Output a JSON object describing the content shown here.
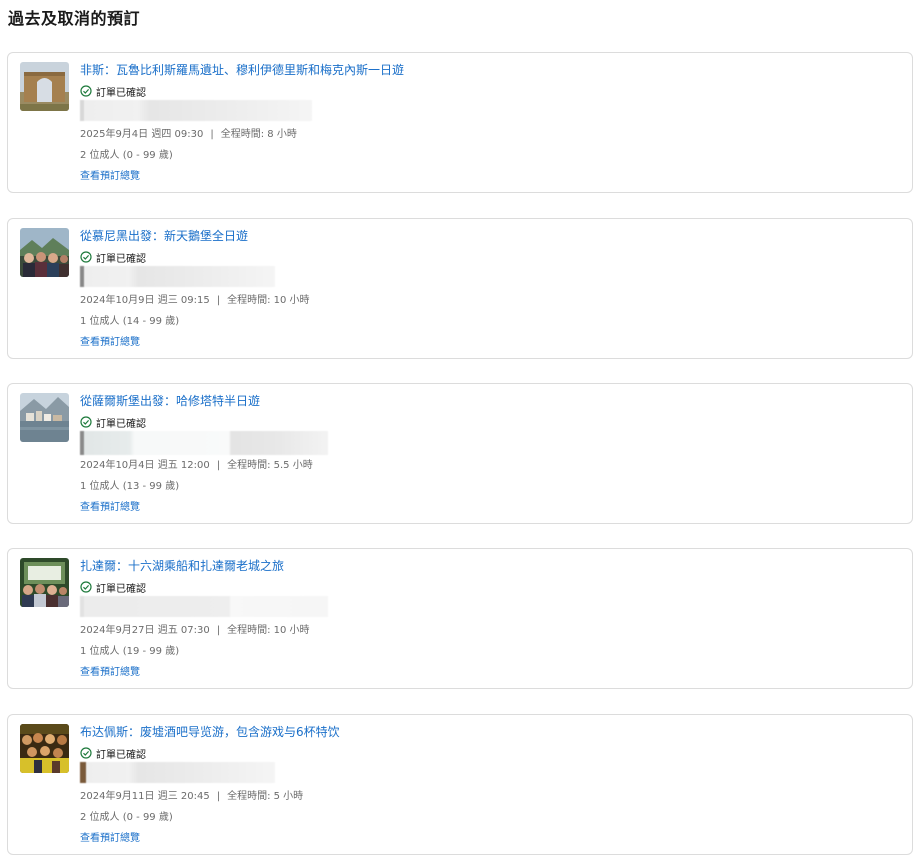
{
  "page": {
    "title": "過去及取消的預訂"
  },
  "bookings": [
    {
      "title": "非斯：瓦魯比利斯羅馬遺址、穆利伊德里斯和梅克內斯一日遊",
      "status": "訂單已確認",
      "date": "2025年9月4日 週四 09:30",
      "separator": "|",
      "duration": "全程時間: 8 小時",
      "people": "2 位成人 (0 - 99 歲)",
      "link": "查看預訂總覽",
      "thumb_icon": "roman-ruins-photo"
    },
    {
      "title": "從慕尼黑出發：新天鵝堡全日遊",
      "status": "訂單已確認",
      "date": "2024年10月9日 週三 09:15",
      "separator": "|",
      "duration": "全程時間: 10 小時",
      "people": "1 位成人 (14 - 99 歲)",
      "link": "查看預訂總覽",
      "thumb_icon": "group-photo-mountains"
    },
    {
      "title": "從薩爾斯堡出發：哈修塔特半日遊",
      "status": "訂單已確認",
      "date": "2024年10月4日 週五 12:00",
      "separator": "|",
      "duration": "全程時間: 5.5 小時",
      "people": "1 位成人 (13 - 99 歲)",
      "link": "查看預訂總覽",
      "thumb_icon": "lake-village-photo"
    },
    {
      "title": "扎達爾：十六湖乘船和扎達爾老城之旅",
      "status": "訂單已確認",
      "date": "2024年9月27日 週五 07:30",
      "separator": "|",
      "duration": "全程時間: 10 小時",
      "people": "1 位成人 (19 - 99 歲)",
      "link": "查看預訂總覽",
      "thumb_icon": "national-park-group-photo"
    },
    {
      "title": "布达佩斯：废墟酒吧导览游，包含游戏与6杯特饮",
      "status": "訂單已確認",
      "date": "2024年9月11日 週三 20:45",
      "separator": "|",
      "duration": "全程時間: 5 小時",
      "people": "2 位成人 (0 - 99 歲)",
      "link": "查看預訂總覽",
      "thumb_icon": "party-crowd-photo"
    }
  ],
  "colors": {
    "link": "#1a6fc9",
    "status_icon": "#1e7a3c",
    "muted_text": "#6b6b6b",
    "border": "#dcdcdc"
  }
}
